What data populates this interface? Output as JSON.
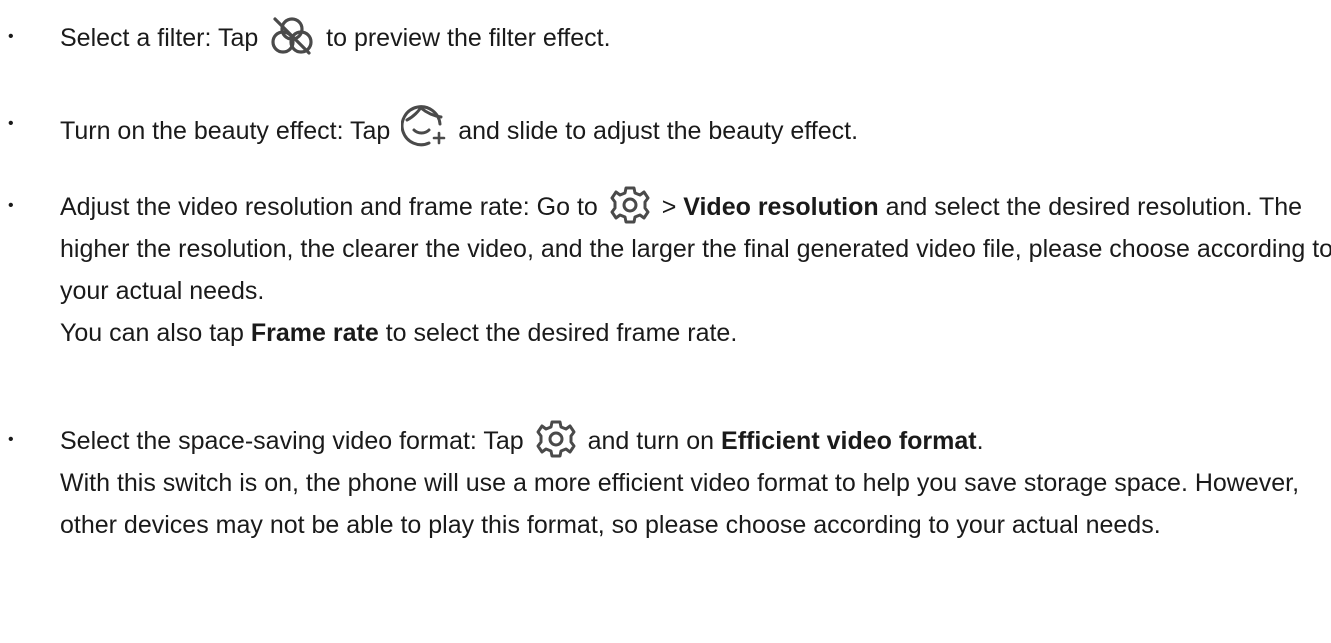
{
  "items": [
    {
      "parts": [
        {
          "t": "Select a filter: Tap "
        },
        {
          "icon": "filter-off-icon"
        },
        {
          "t": " to preview the filter effect."
        }
      ]
    },
    {
      "parts": [
        {
          "t": "Turn on the beauty effect: Tap "
        },
        {
          "icon": "beauty-face-icon"
        },
        {
          "t": " and slide to adjust the beauty effect."
        }
      ]
    },
    {
      "parts": [
        {
          "t": "Adjust the video resolution and frame rate: Go to "
        },
        {
          "icon": "gear-icon"
        },
        {
          "t": " > "
        },
        {
          "b": "Video resolution"
        },
        {
          "t": " and select the desired resolution. The higher the resolution, the clearer the video, and the larger the final generated video file, please choose according to your actual needs."
        },
        {
          "br": true
        },
        {
          "t": "You can also tap "
        },
        {
          "b": "Frame rate"
        },
        {
          "t": " to select the desired frame rate."
        }
      ]
    },
    {
      "parts": [
        {
          "t": "Select the space-saving video format: Tap "
        },
        {
          "icon": "gear-icon"
        },
        {
          "t": " and turn on "
        },
        {
          "b": "Efficient video format"
        },
        {
          "t": "."
        },
        {
          "br": true
        },
        {
          "t": "With this switch is on, the phone will use a more efficient video format to help you save storage space. However, other devices may not be able to play this format, so please choose according to your actual needs."
        }
      ]
    }
  ]
}
